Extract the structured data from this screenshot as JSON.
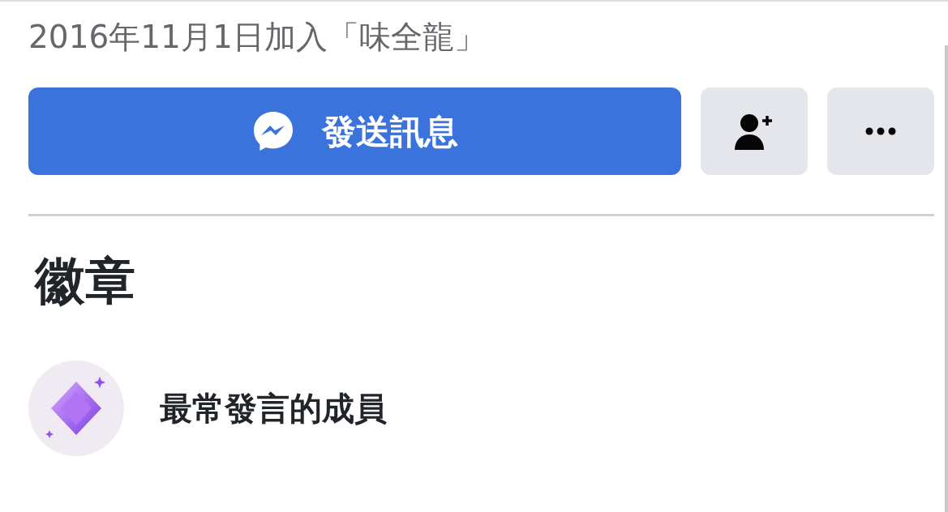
{
  "joined_text": "2016年11月1日加入「味全龍」",
  "actions": [
    {
      "kind": "message",
      "label": "發送訊息"
    },
    {
      "kind": "add_friend"
    },
    {
      "kind": "more"
    }
  ],
  "badges_section": {
    "title": "徽章",
    "badges": [
      {
        "label": "最常發言的成員"
      }
    ]
  }
}
